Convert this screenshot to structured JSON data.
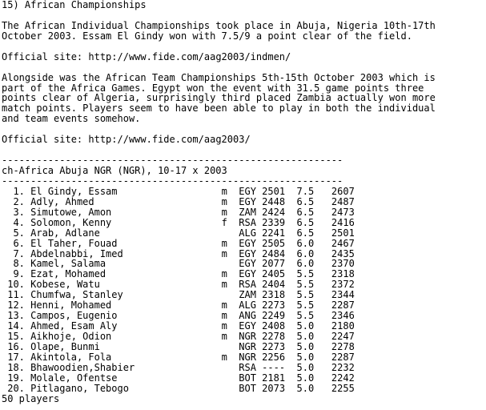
{
  "heading": "15) African Championships",
  "para1": [
    "The African Individual Championships took place in Abuja, Nigeria 10th-17th",
    "October 2003. Essam El Gindy won with 7.5/9 a point clear of the field."
  ],
  "official1": {
    "prefix": "Official site: ",
    "url": "http://www.fide.com/aag2003/indmen/"
  },
  "para2": [
    "Alongside was the African Team Championships 5th-15th October 2003 which is",
    "part of the Africa Games. Egypt won the event with 31.5 game points three",
    "points clear of Algeria, surprisingly third placed Zambia actually won more",
    "match points. Players seem to have been able to play in both the individual",
    "and team events somehow."
  ],
  "official2": {
    "prefix": "Official site: ",
    "url": "http://www.fide.com/aag2003/"
  },
  "separator": "-----------------------------------------------------------",
  "table": {
    "title": "ch-Africa Abuja NGR (NGR), 10-17 x 2003",
    "rows": [
      {
        "num": "1.",
        "name": "El Gindy, Essam",
        "sex": "m",
        "fed": "EGY",
        "rating": "2501",
        "score": "7.5",
        "perf": "2607"
      },
      {
        "num": "2.",
        "name": "Adly, Ahmed",
        "sex": "m",
        "fed": "EGY",
        "rating": "2448",
        "score": "6.5",
        "perf": "2487"
      },
      {
        "num": "3.",
        "name": "Simutowe, Amon",
        "sex": "m",
        "fed": "ZAM",
        "rating": "2424",
        "score": "6.5",
        "perf": "2473"
      },
      {
        "num": "4.",
        "name": "Solomon, Kenny",
        "sex": "f",
        "fed": "RSA",
        "rating": "2339",
        "score": "6.5",
        "perf": "2416"
      },
      {
        "num": "5.",
        "name": "Arab, Adlane",
        "sex": "",
        "fed": "ALG",
        "rating": "2241",
        "score": "6.5",
        "perf": "2501"
      },
      {
        "num": "6.",
        "name": "El Taher, Fouad",
        "sex": "m",
        "fed": "EGY",
        "rating": "2505",
        "score": "6.0",
        "perf": "2467"
      },
      {
        "num": "7.",
        "name": "Abdelnabbi, Imed",
        "sex": "m",
        "fed": "EGY",
        "rating": "2484",
        "score": "6.0",
        "perf": "2435"
      },
      {
        "num": "8.",
        "name": "Kamel, Salama",
        "sex": "",
        "fed": "EGY",
        "rating": "2077",
        "score": "6.0",
        "perf": "2370"
      },
      {
        "num": "9.",
        "name": "Ezat, Mohamed",
        "sex": "m",
        "fed": "EGY",
        "rating": "2405",
        "score": "5.5",
        "perf": "2318"
      },
      {
        "num": "10.",
        "name": "Kobese, Watu",
        "sex": "m",
        "fed": "RSA",
        "rating": "2404",
        "score": "5.5",
        "perf": "2372"
      },
      {
        "num": "11.",
        "name": "Chumfwa, Stanley",
        "sex": "",
        "fed": "ZAM",
        "rating": "2318",
        "score": "5.5",
        "perf": "2344"
      },
      {
        "num": "12.",
        "name": "Henni, Mohamed",
        "sex": "m",
        "fed": "ALG",
        "rating": "2273",
        "score": "5.5",
        "perf": "2287"
      },
      {
        "num": "13.",
        "name": "Campos, Eugenio",
        "sex": "m",
        "fed": "ANG",
        "rating": "2249",
        "score": "5.5",
        "perf": "2346"
      },
      {
        "num": "14.",
        "name": "Ahmed, Esam Aly",
        "sex": "m",
        "fed": "EGY",
        "rating": "2408",
        "score": "5.0",
        "perf": "2180"
      },
      {
        "num": "15.",
        "name": "Aikhoje, Odion",
        "sex": "m",
        "fed": "NGR",
        "rating": "2278",
        "score": "5.0",
        "perf": "2247"
      },
      {
        "num": "16.",
        "name": "Olape, Bunmi",
        "sex": "",
        "fed": "NGR",
        "rating": "2273",
        "score": "5.0",
        "perf": "2278"
      },
      {
        "num": "17.",
        "name": "Akintola, Fola",
        "sex": "m",
        "fed": "NGR",
        "rating": "2256",
        "score": "5.0",
        "perf": "2287"
      },
      {
        "num": "18.",
        "name": "Bhawoodien,Shabier",
        "sex": "",
        "fed": "RSA",
        "rating": "----",
        "score": "5.0",
        "perf": "2232"
      },
      {
        "num": "19.",
        "name": "Molale, Ofentse",
        "sex": "",
        "fed": "BOT",
        "rating": "2181",
        "score": "5.0",
        "perf": "2242"
      },
      {
        "num": "20.",
        "name": "Pitlagano, Tebogo",
        "sex": "",
        "fed": "BOT",
        "rating": "2073",
        "score": "5.0",
        "perf": "2255"
      }
    ],
    "footer": "50 players"
  }
}
